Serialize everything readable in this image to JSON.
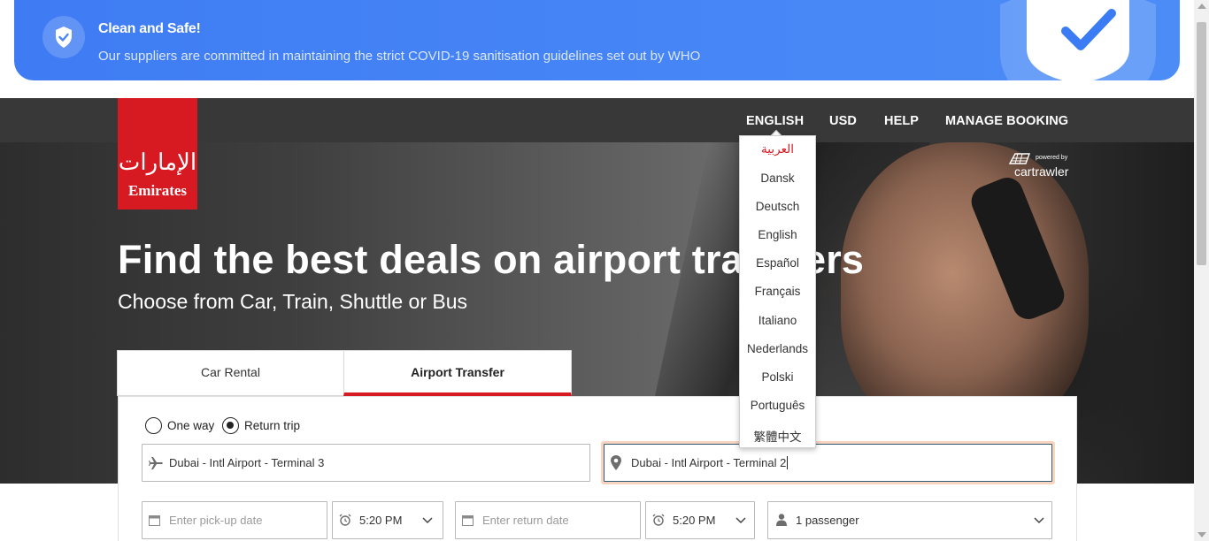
{
  "banner": {
    "title": "Clean and Safe!",
    "text": "Our suppliers are committed in maintaining the strict COVID-19 sanitisation guidelines set out by WHO",
    "icon": "shield-check-icon"
  },
  "brand": {
    "logo_text": "Emirates",
    "logo_mark": "ﺍﻹﻣﺎﺭﺍﺕ",
    "accent_color": "#d71921",
    "partner_powered": "powered by",
    "partner_name": "cartrawler"
  },
  "nav": {
    "language": "ENGLISH",
    "currency": "USD",
    "help": "HELP",
    "manage_booking": "MANAGE BOOKING"
  },
  "language_menu": {
    "selected": "العربية",
    "options": [
      "العربية",
      "Dansk",
      "Deutsch",
      "English",
      "Español",
      "Français",
      "Italiano",
      "Nederlands",
      "Polski",
      "Português",
      "繁體中文"
    ]
  },
  "hero": {
    "title": "Find the best deals on airport transfers",
    "subtitle": "Choose from Car, Train, Shuttle or Bus"
  },
  "tabs": {
    "car_rental": "Car Rental",
    "airport_transfer": "Airport Transfer",
    "active": "Airport Transfer"
  },
  "form": {
    "trip_one_way": "One way",
    "trip_return": "Return trip",
    "trip_selected": "Return trip",
    "from_value": "Dubai - Intl Airport - Terminal 3",
    "to_value": "Dubai - Intl Airport - Terminal 2",
    "pickup_date_placeholder": "Enter pick-up date",
    "pickup_time": "5:20 PM",
    "return_date_placeholder": "Enter return date",
    "return_time": "5:20 PM",
    "passengers": "1 passenger"
  }
}
